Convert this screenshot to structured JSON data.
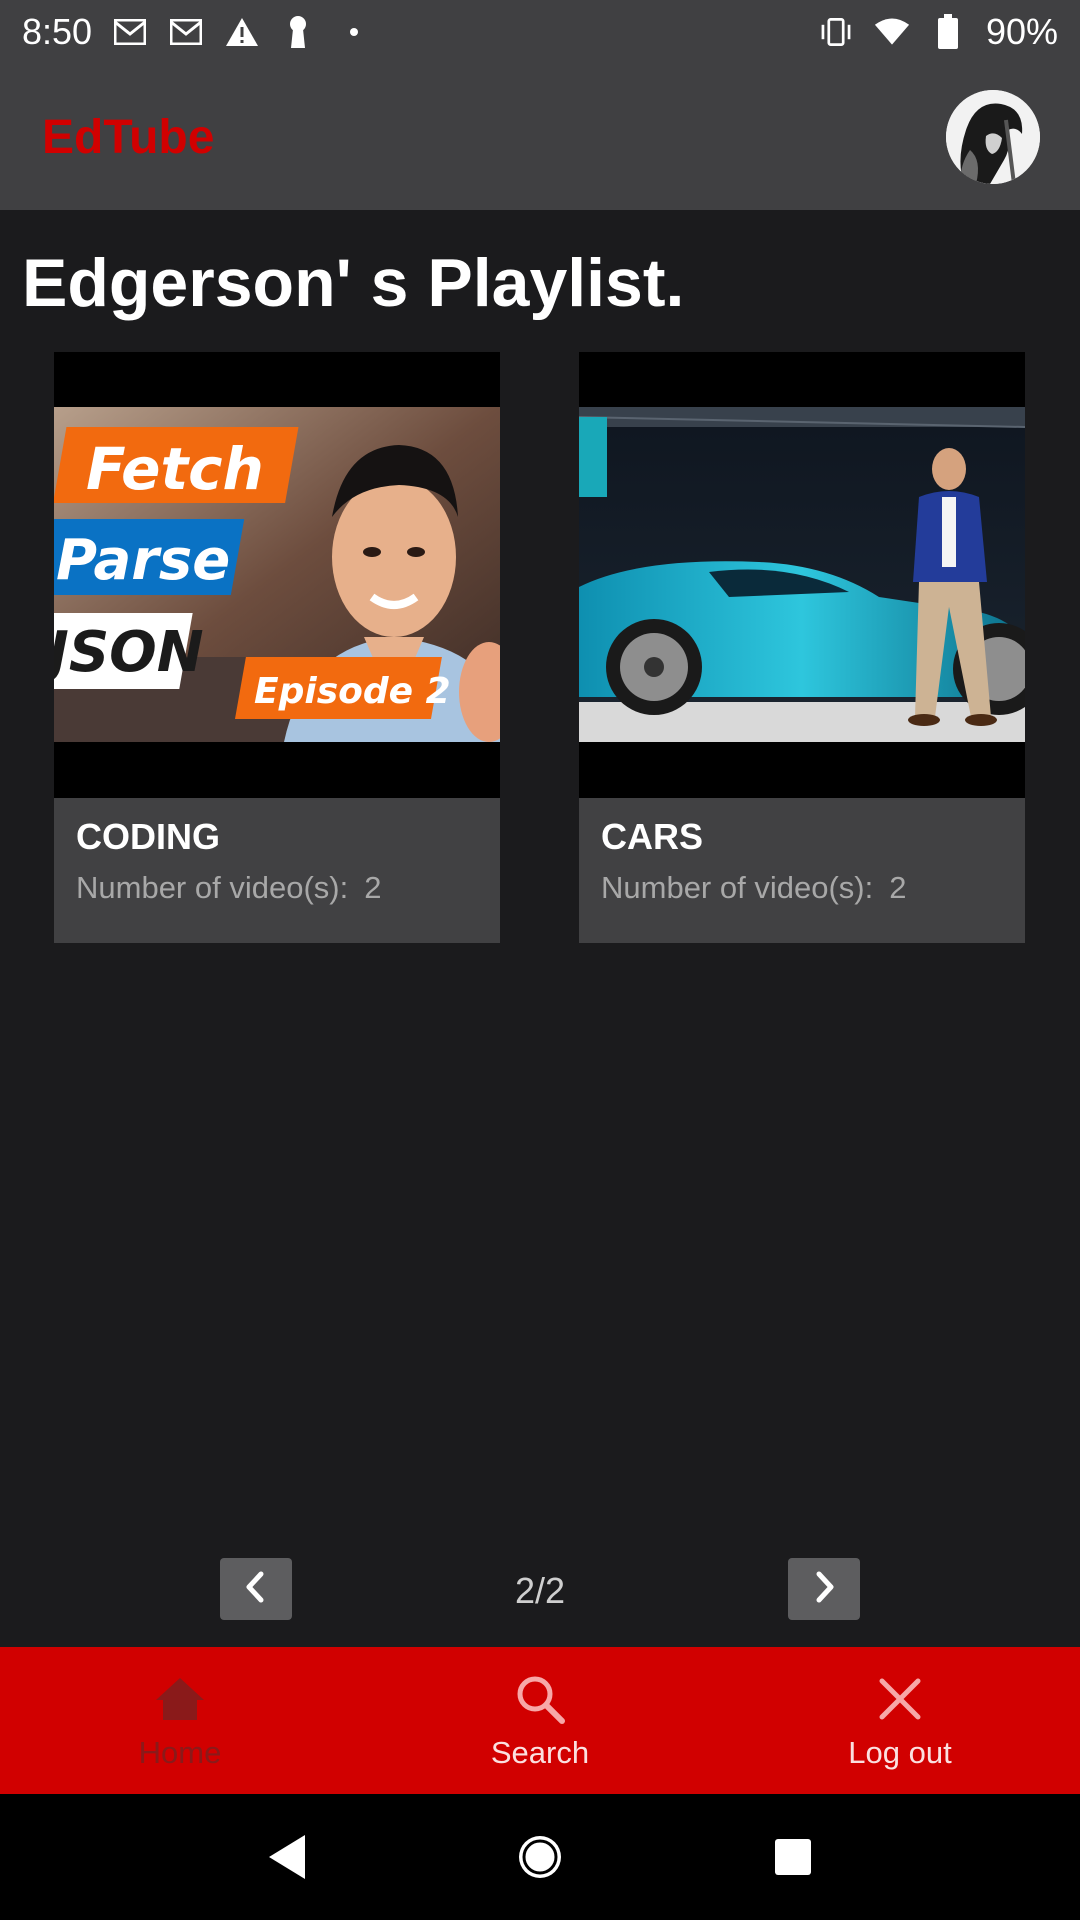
{
  "status": {
    "time": "8:50",
    "battery": "90%",
    "icons": [
      "gmail-icon",
      "gmail-icon",
      "warning-icon",
      "keyhole-icon",
      "dot-icon",
      "vibrate-icon",
      "wifi-icon",
      "battery-icon"
    ]
  },
  "app_bar": {
    "title": "EdTube",
    "title_color": "#d10000"
  },
  "page": {
    "title": "Edgerson' s Playlist."
  },
  "playlists": [
    {
      "name": "CODING",
      "count_label": "Number of video(s):",
      "count": "2",
      "thumbnail_text": [
        "Fetch",
        "Parse",
        "JSON",
        "Episode 2"
      ]
    },
    {
      "name": "CARS",
      "count_label": "Number of video(s):",
      "count": "2"
    }
  ],
  "pagination": {
    "indicator": "2/2"
  },
  "bottom_nav": {
    "items": [
      {
        "label": "Home",
        "icon": "home-icon",
        "active": true
      },
      {
        "label": "Search",
        "icon": "search-icon",
        "active": false
      },
      {
        "label": "Log out",
        "icon": "close-icon",
        "active": false
      }
    ]
  },
  "colors": {
    "accent": "#d10000",
    "surface": "#404042",
    "background": "#1b1b1d"
  }
}
